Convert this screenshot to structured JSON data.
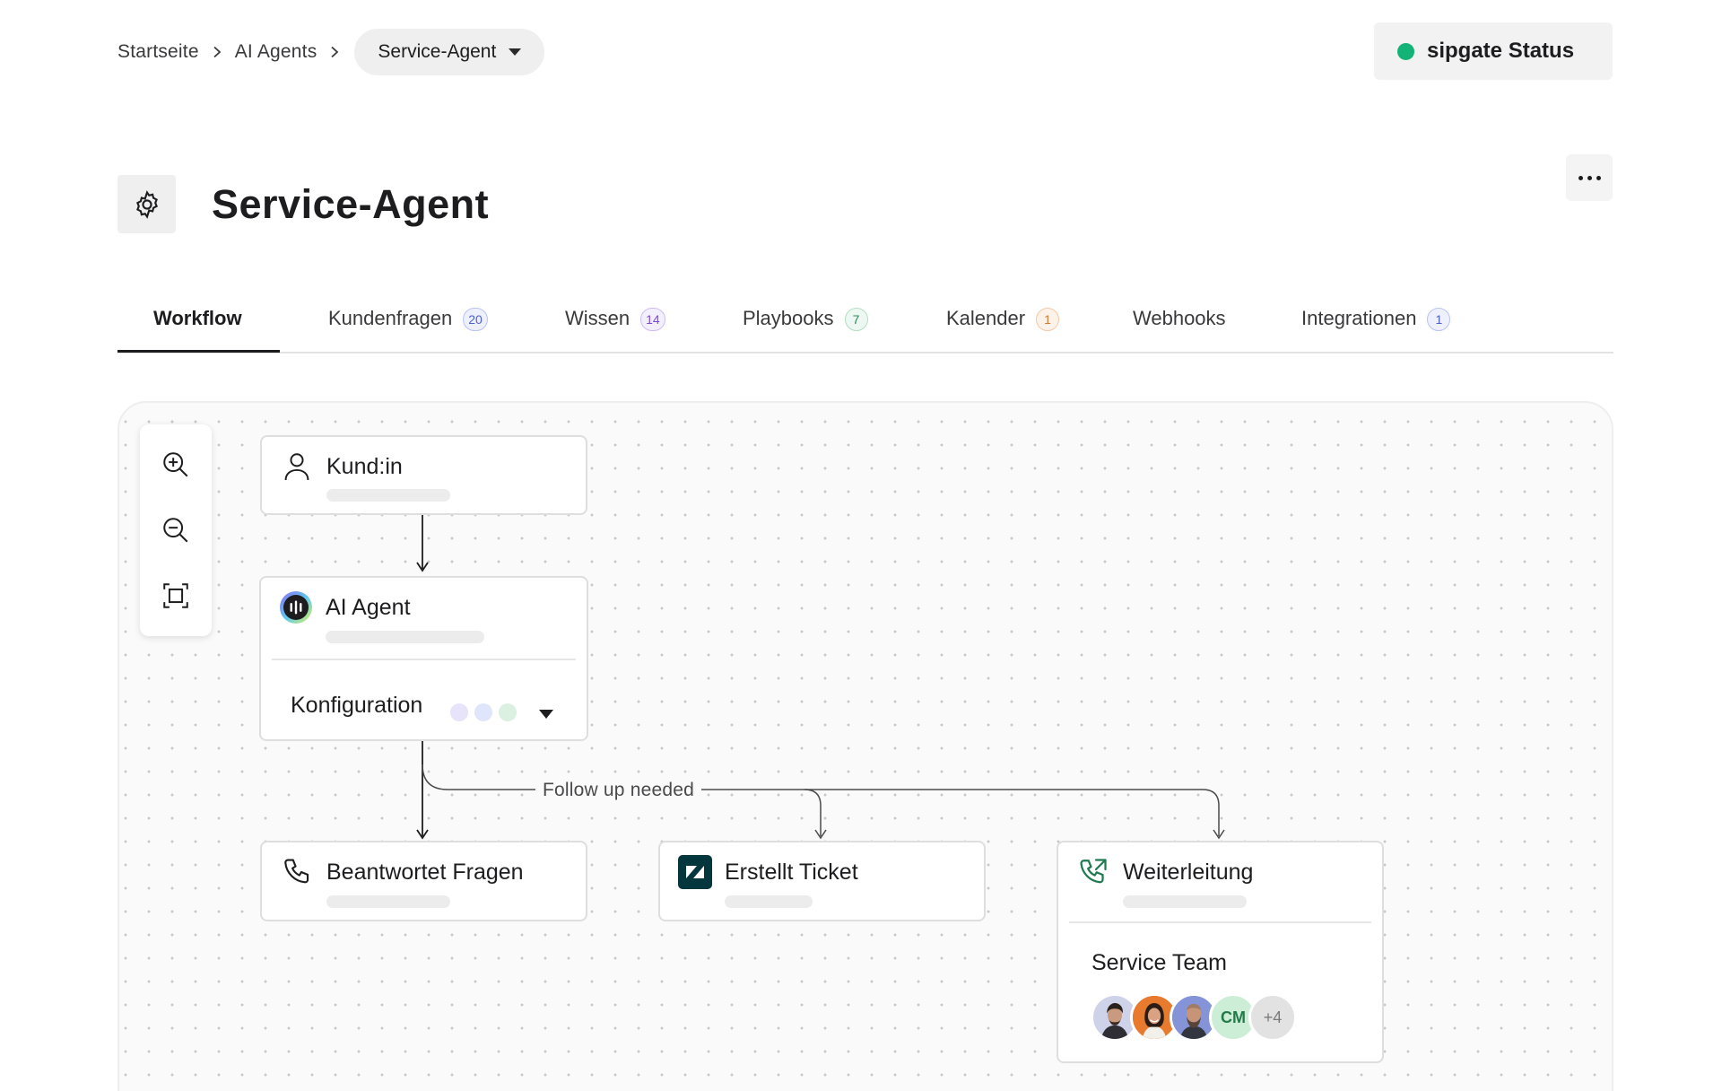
{
  "breadcrumb": {
    "items": [
      "Startseite",
      "AI Agents"
    ],
    "current": "Service-Agent"
  },
  "status_button": {
    "label": "sipgate Status",
    "dot_color": "#13b378"
  },
  "page": {
    "title": "Service-Agent"
  },
  "tabs": [
    {
      "label": "Workflow",
      "active": true
    },
    {
      "label": "Kundenfragen",
      "badge": "20",
      "badge_color": "blue"
    },
    {
      "label": "Wissen",
      "badge": "14",
      "badge_color": "purple"
    },
    {
      "label": "Playbooks",
      "badge": "7",
      "badge_color": "green"
    },
    {
      "label": "Kalender",
      "badge": "1",
      "badge_color": "orange"
    },
    {
      "label": "Webhooks"
    },
    {
      "label": "Integrationen",
      "badge": "1",
      "badge_color": "blue"
    }
  ],
  "zoom_controls": [
    "zoom-in-icon",
    "zoom-out-icon",
    "fit-view-icon"
  ],
  "workflow": {
    "customer_node": {
      "title": "Kund:in",
      "icon": "user-icon"
    },
    "agent_node": {
      "title": "AI Agent",
      "icon": "ai-agent-logo-icon",
      "config_label": "Konfiguration",
      "config_dot_colors": [
        "#e6e3fb",
        "#dfe5fb",
        "#dcf0e1"
      ]
    },
    "edge_label": "Follow up needed",
    "answer_node": {
      "title": "Beantwortet Fragen",
      "icon": "phone-icon"
    },
    "ticket_node": {
      "title": "Erstellt Ticket",
      "icon": "zendesk-logo-icon"
    },
    "forward_node": {
      "title": "Weiterleitung",
      "icon": "phone-forward-icon",
      "team_label": "Service Team",
      "members": [
        "avatar-1",
        "avatar-2",
        "avatar-3"
      ],
      "initials": "CM",
      "more": "+4"
    }
  }
}
